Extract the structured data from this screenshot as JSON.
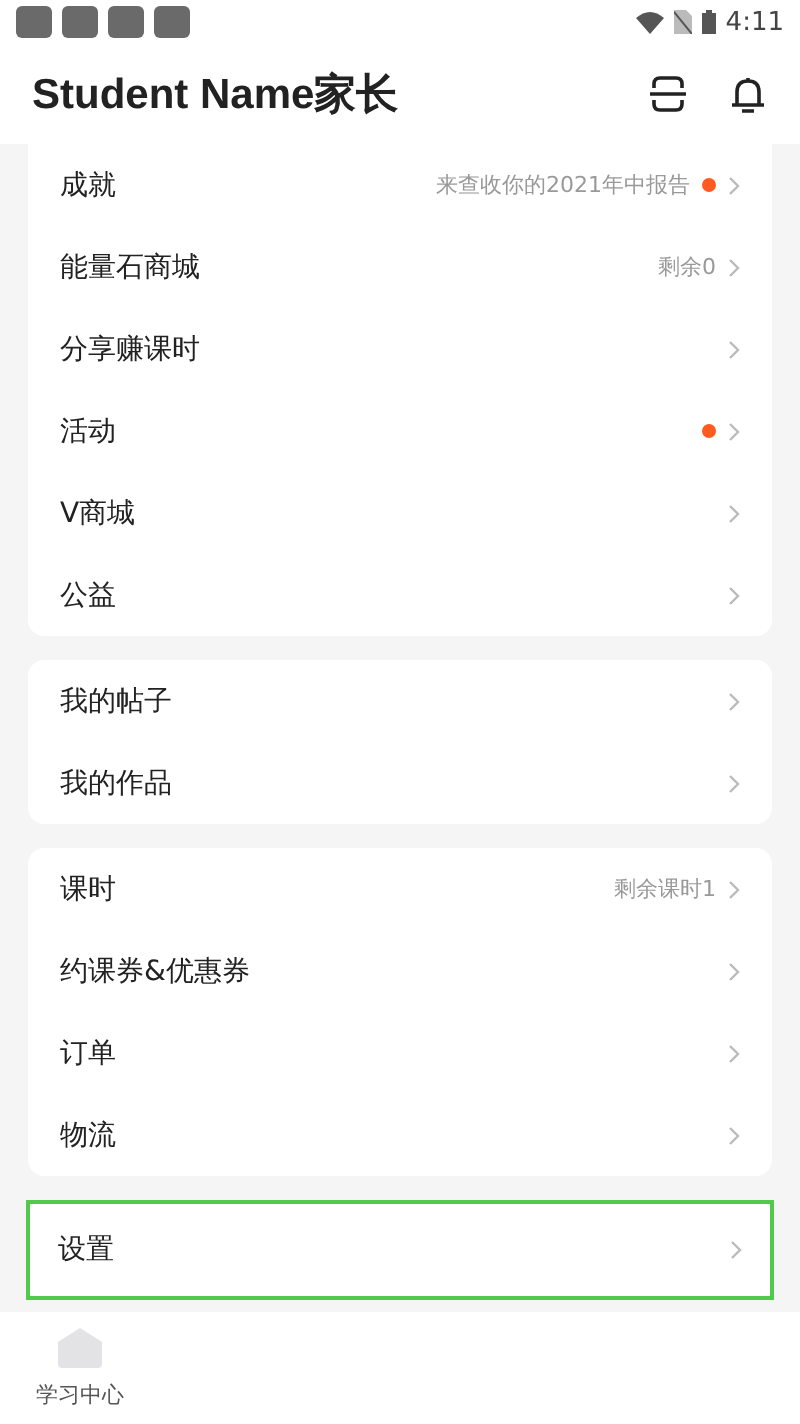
{
  "status_bar": {
    "time": "4:11"
  },
  "header": {
    "title": "Student Name家长"
  },
  "groups": [
    {
      "items": [
        {
          "label": "成就",
          "note": "来查收你的2021年中报告",
          "dot": true,
          "highlighted": false
        },
        {
          "label": "能量石商城",
          "note": "剩余0",
          "dot": false,
          "highlighted": false
        },
        {
          "label": "分享赚课时",
          "dot": false,
          "highlighted": false
        },
        {
          "label": "活动",
          "dot": true,
          "highlighted": false
        },
        {
          "label": "V商城",
          "dot": false,
          "highlighted": false
        },
        {
          "label": "公益",
          "dot": false,
          "highlighted": false
        }
      ]
    },
    {
      "items": [
        {
          "label": "我的帖子",
          "dot": false,
          "highlighted": false
        },
        {
          "label": "我的作品",
          "dot": false,
          "highlighted": false
        }
      ]
    },
    {
      "items": [
        {
          "label": "课时",
          "note": "剩余课时1",
          "dot": false,
          "highlighted": false
        },
        {
          "label": "约课券&优惠券",
          "dot": false,
          "highlighted": false
        },
        {
          "label": "订单",
          "dot": false,
          "highlighted": false
        },
        {
          "label": "物流",
          "dot": false,
          "highlighted": false
        }
      ]
    },
    {
      "items": [
        {
          "label": "设置",
          "dot": false,
          "highlighted": true
        }
      ]
    }
  ],
  "tab_bar": [
    {
      "label": "学习中心",
      "selected": false
    }
  ]
}
